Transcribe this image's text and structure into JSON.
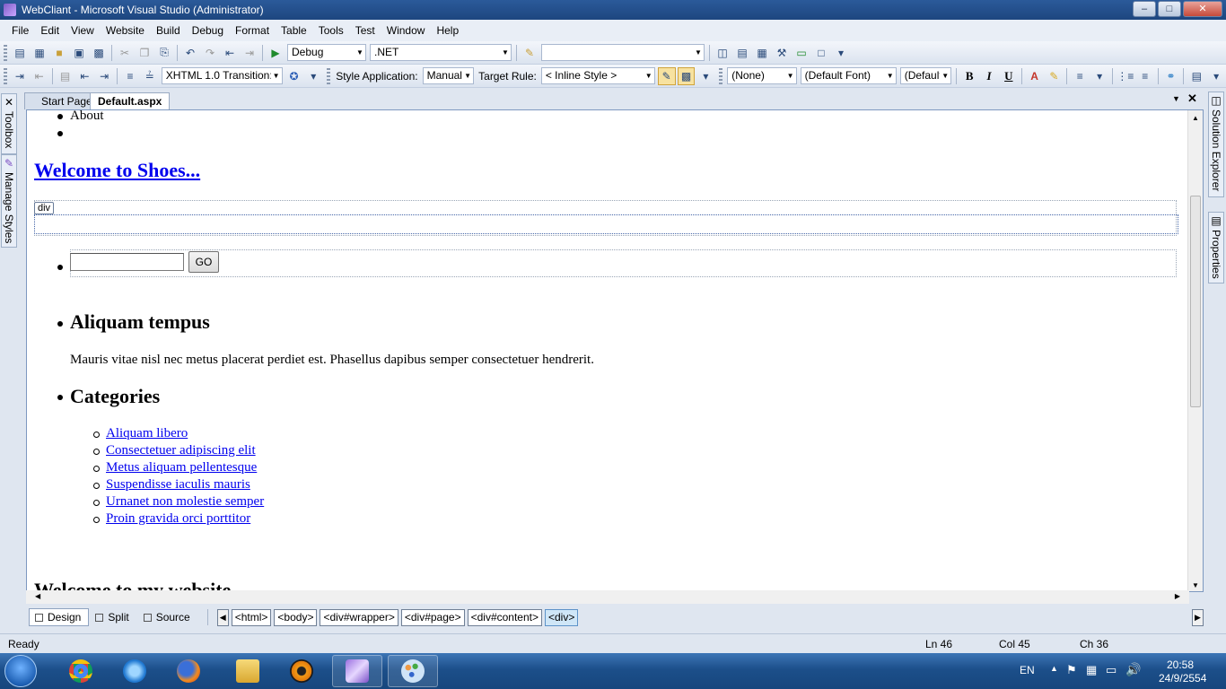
{
  "window": {
    "title": "WebCliant - Microsoft Visual Studio (Administrator)",
    "controls": [
      "–",
      "□",
      "✕"
    ]
  },
  "menu": [
    "File",
    "Edit",
    "View",
    "Website",
    "Build",
    "Debug",
    "Format",
    "Table",
    "Tools",
    "Test",
    "Window",
    "Help"
  ],
  "toolbar1": {
    "config": "Debug",
    "platform": ".NET",
    "find": ""
  },
  "toolbar2": {
    "doctype": "XHTML 1.0 Transition:",
    "style_application_label": "Style Application:",
    "style_application_value": "Manual",
    "target_rule_label": "Target Rule:",
    "target_rule_value": "< Inline Style >",
    "block_format": "(None)",
    "font_name": "(Default Font)",
    "font_size": "(Default",
    "bold": "B",
    "italic": "I",
    "underline": "U"
  },
  "side_left": [
    "Toolbox",
    "Manage Styles"
  ],
  "side_right": [
    "Solution Explorer",
    "Properties"
  ],
  "tabs": [
    {
      "label": "Start Page",
      "active": false
    },
    {
      "label": "Default.aspx",
      "active": true
    }
  ],
  "editor": {
    "nav_link": "About",
    "heading": "Welcome to Shoes...",
    "div_tag": "div",
    "search_value": "",
    "go_button": "GO",
    "section1_title": "Aliquam tempus",
    "section1_text": "Mauris vitae nisl nec metus placerat perdiet est. Phasellus dapibus semper consectetuer hendrerit.",
    "section2_title": "Categories",
    "categories": [
      "Aliquam libero",
      "Consectetuer adipiscing elit",
      "Metus aliquam pellentesque",
      "Suspendisse iaculis mauris",
      "Urnanet non molestie semper",
      "Proin gravida orci porttitor"
    ],
    "bottom_heading": "Welcome to my website"
  },
  "view_buttons": [
    "Design",
    "Split",
    "Source"
  ],
  "breadcrumbs": [
    "<html>",
    "<body>",
    "<div#wrapper>",
    "<div#page>",
    "<div#content>",
    "<div>"
  ],
  "status": {
    "state": "Ready",
    "line": "Ln 46",
    "col": "Col 45",
    "ch": "Ch 36"
  },
  "taskbar": {
    "apps": [
      "chrome-icon",
      "ie-icon",
      "firefox-icon",
      "explorer-icon",
      "vlc-icon",
      "visual-studio-icon",
      "paint-icon"
    ],
    "language": "EN",
    "time": "20:58",
    "date": "24/9/2554"
  },
  "colors": {
    "title_bar": "#1d467f",
    "link": "#0000ee",
    "taskbar": "#1c4f8a"
  }
}
